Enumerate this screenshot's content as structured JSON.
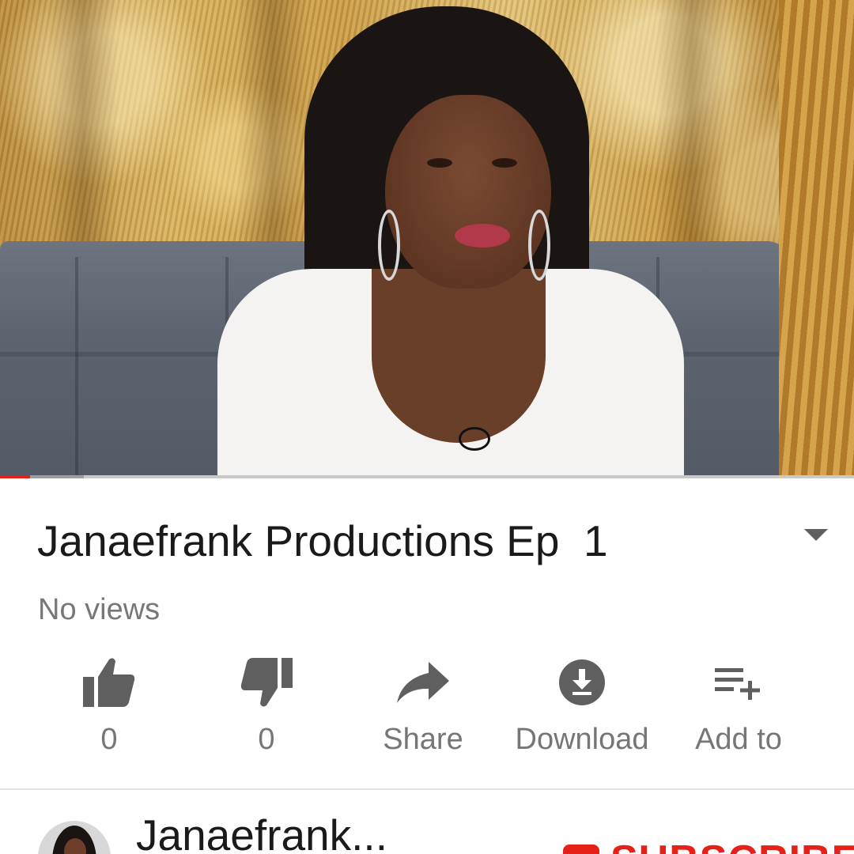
{
  "video": {
    "progress_played": 0.035,
    "progress_buffered": 0.098
  },
  "info": {
    "title": "Janaefrank Productions Ep  1",
    "views": "No views"
  },
  "actions": [
    {
      "icon": "thumbs-up-icon",
      "label": "0"
    },
    {
      "icon": "thumbs-down-icon",
      "label": "0"
    },
    {
      "icon": "share-icon",
      "label": "Share"
    },
    {
      "icon": "download-icon",
      "label": "Download"
    },
    {
      "icon": "playlist-add-icon",
      "label": "Add to"
    }
  ],
  "channel": {
    "name": "Janaefrank...",
    "subscribe_label": "SUBSCRIBE"
  },
  "colors": {
    "accent": "#e62117",
    "text_primary": "#1a1a1a",
    "text_secondary": "#767676"
  }
}
